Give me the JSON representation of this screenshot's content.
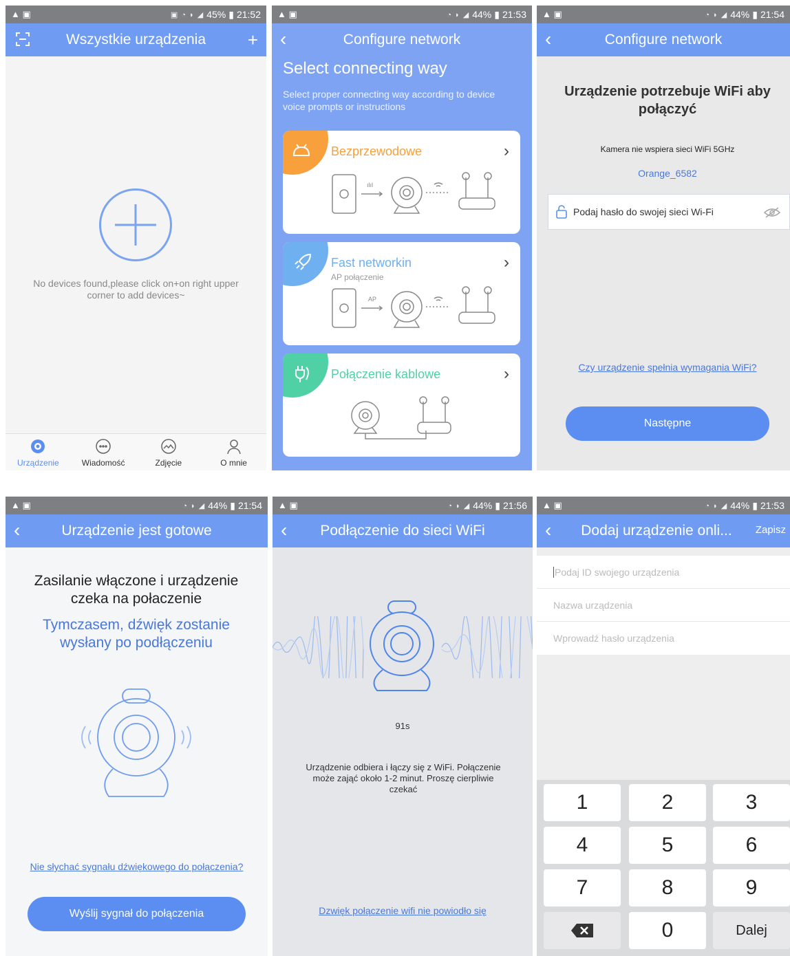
{
  "screens": {
    "s1": {
      "status": {
        "left": "▲ ▣",
        "right": "45%",
        "time": "21:52"
      },
      "title": "Wszystkie urządzenia",
      "empty_text": "No devices found,please click on+on right upper corner to add devices~",
      "tabs": [
        {
          "label": "Urządzenie",
          "active": true
        },
        {
          "label": "Wiadomość",
          "active": false
        },
        {
          "label": "Zdjęcie",
          "active": false
        },
        {
          "label": "O mnie",
          "active": false
        }
      ]
    },
    "s2": {
      "status": {
        "left": "▲ ▣",
        "right": "44%",
        "time": "21:53"
      },
      "title": "Configure network",
      "heading": "Select connecting way",
      "subheading": "Select proper connecting way according to device voice prompts or instructions",
      "cards": [
        {
          "label": "Bezprzewodowe",
          "sub": "",
          "color": "#f7a03c",
          "diag_label": "ılıl"
        },
        {
          "label": "Fast networkin",
          "sub": "AP połączenie",
          "color": "#6fb0f0",
          "diag_label": "AP"
        },
        {
          "label": "Połączenie kablowe",
          "sub": "",
          "color": "#4fd1a5",
          "diag_label": ""
        }
      ]
    },
    "s3": {
      "status": {
        "left": "▲ ▣",
        "right": "44%",
        "time": "21:54"
      },
      "title": "Configure network",
      "heading": "Urządzenie potrzebuje WiFi aby połączyć",
      "note": "Kamera nie wspiera sieci WiFi 5GHz",
      "ssid": "Orange_6582",
      "password_placeholder": "Podaj hasło do swojej sieci Wi-Fi",
      "link": "Czy urządzenie spełnia wymagania WiFi?",
      "button": "Następne"
    },
    "s4": {
      "status": {
        "left": "▲ ▣",
        "right": "44%",
        "time": "21:54"
      },
      "title": "Urządzenie jest gotowe",
      "heading": "Zasilanie włączone i urządzenie czeka na połaczenie",
      "subheading": "Tymczasem, dźwięk zostanie wysłany po podłączeniu",
      "link": "Nie słychać sygnału dźwiękowego do połączenia?",
      "button": "Wyślij sygnał do połączenia"
    },
    "s5": {
      "status": {
        "left": "▲ ▣",
        "right": "44%",
        "time": "21:56"
      },
      "title": "Podłączenie do sieci WiFi",
      "countdown": "91s",
      "message": "Urządzenie odbiera i łączy się z WiFi. Połączenie może zająć około 1-2 minut. Proszę cierpliwie czekać",
      "link": "Dzwięk połączenie wifi nie powiodło się"
    },
    "s6": {
      "status": {
        "left": "▲ ▣",
        "right": "44%",
        "time": "21:53"
      },
      "title": "Dodaj urządzenie onli...",
      "save": "Zapisz",
      "fields": [
        "Podaj ID swojego urządzenia",
        "Nazwa urządzenia",
        "Wprowadź hasło urządzenia"
      ],
      "keys": [
        "1",
        "2",
        "3",
        "4",
        "5",
        "6",
        "7",
        "8",
        "9",
        "⌫",
        "0",
        "Dalej"
      ]
    }
  },
  "colors": {
    "accent": "#6f9cf2",
    "button": "#5b8ef0",
    "link": "#4a78d9",
    "orange": "#f7a03c"
  }
}
